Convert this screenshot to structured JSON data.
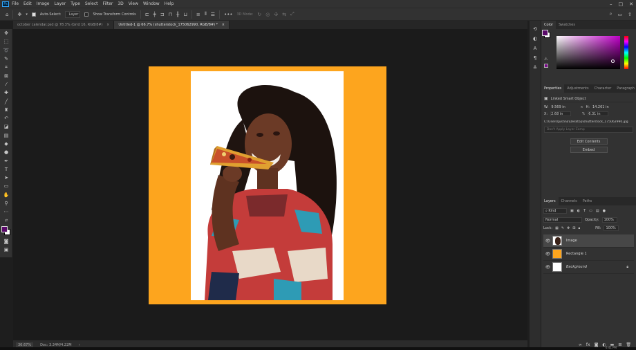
{
  "menu": {
    "logo": "Ps",
    "items": [
      "File",
      "Edit",
      "Image",
      "Layer",
      "Type",
      "Select",
      "Filter",
      "3D",
      "View",
      "Window",
      "Help"
    ]
  },
  "options": {
    "auto_select_label": "Auto-Select:",
    "auto_select_value": "Layer",
    "show_transform_label": "Show Transform Controls",
    "mode_3d": "3D Mode:"
  },
  "tabs": [
    {
      "label": "october calendar.psd @ 78.3% (Grid 16, RGB/8#)",
      "close": "×"
    },
    {
      "label": "Untitled-1 @ 66.7% (shutterstock_175062990, RGB/8#) *",
      "close": "×"
    }
  ],
  "status": {
    "zoom": "36.67%",
    "doc": "Doc: 3.34M/4.22M",
    "arrow": "›"
  },
  "color_panel": {
    "tabs": [
      "Color",
      "Swatches"
    ],
    "accent": "#7a0a8a"
  },
  "properties": {
    "tabs": [
      "Properties",
      "Adjustments",
      "Character",
      "Paragraph"
    ],
    "type": "Linked Smart Object",
    "w_label": "W:",
    "w_value": "9.569 in",
    "h_label": "H:",
    "h_value": "14.261 in",
    "x_label": "X:",
    "x_value": "2.68 in",
    "y_label": "Y:",
    "y_value": "6.31 in",
    "path": "C:\\Users\\Justina\\Desktop\\shutterstock_175062990.jpg",
    "comp_placeholder": "Don't Apply Layer Comp",
    "edit_button": "Edit Contents",
    "embed_button": "Embed"
  },
  "layers": {
    "tabs": [
      "Layers",
      "Channels",
      "Paths"
    ],
    "kind": "Kind",
    "blend": "Normal",
    "opacity_label": "Opacity:",
    "opacity_value": "100%",
    "lock_label": "Lock:",
    "fill_label": "Fill:",
    "fill_value": "100%",
    "items": [
      {
        "name": "Image",
        "italic": false
      },
      {
        "name": "Rectangle 1",
        "italic": false
      },
      {
        "name": "Background",
        "italic": true
      }
    ]
  },
  "clock": "6:41 PM",
  "colors": {
    "orange": "#fda51e",
    "fg_swatch": "#5a0a6a"
  }
}
